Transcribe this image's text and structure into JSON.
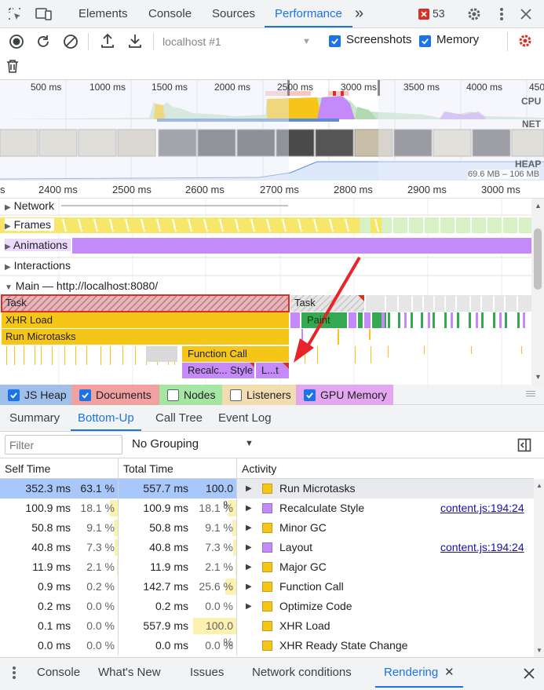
{
  "tabs": {
    "items": [
      {
        "label": "Elements"
      },
      {
        "label": "Console"
      },
      {
        "label": "Sources"
      },
      {
        "label": "Performance"
      }
    ],
    "more_label": "»",
    "error_count": "53"
  },
  "toolbar": {
    "profile_select": "localhost #1",
    "screenshots_label": "Screenshots",
    "screenshots_checked": true,
    "memory_label": "Memory",
    "memory_checked": true
  },
  "overview": {
    "ticks": [
      "500 ms",
      "1000 ms",
      "1500 ms",
      "2000 ms",
      "2500 ms",
      "3000 ms",
      "3500 ms",
      "4000 ms",
      "450"
    ],
    "cpu_label": "CPU",
    "net_label": "NET",
    "heap_label": "HEAP",
    "heap_range": "69.6 MB – 106 MB"
  },
  "ruler": {
    "ticks": [
      "s",
      "2400 ms",
      "2500 ms",
      "2600 ms",
      "2700 ms",
      "2800 ms",
      "2900 ms",
      "3000 ms"
    ]
  },
  "tracks": {
    "network": "Network",
    "frames": "Frames",
    "animations": "Animations",
    "interactions": "Interactions",
    "main": "Main — http://localhost:8080/"
  },
  "flame": {
    "task1": "Task",
    "task2": "Task",
    "xhr_load": "XHR Load",
    "paint": "Paint",
    "run_microtasks": "Run Microtasks",
    "function_call": "Function Call",
    "recalc": "Recalc... Style",
    "layout": "L...t"
  },
  "memory_counters": [
    {
      "label": "JS Heap",
      "checked": true,
      "color": "#a0c0ec"
    },
    {
      "label": "Documents",
      "checked": true,
      "color": "#f2a1a1"
    },
    {
      "label": "Nodes",
      "checked": false,
      "color": "#a5e6a5"
    },
    {
      "label": "Listeners",
      "checked": false,
      "color": "#f2ddb0"
    },
    {
      "label": "GPU Memory",
      "checked": true,
      "color": "#e2a7ee"
    }
  ],
  "subtabs": [
    "Summary",
    "Bottom-Up",
    "Call Tree",
    "Event Log"
  ],
  "filter": {
    "placeholder": "Filter",
    "grouping": "No Grouping"
  },
  "table": {
    "headers": {
      "self_time": "Self Time",
      "total_time": "Total Time",
      "activity": "Activity"
    },
    "rows": [
      {
        "self": "352.3 ms",
        "self_pct": "63.1 %",
        "self_frac": 0.631,
        "total": "557.7 ms",
        "total_pct": "100.0 %",
        "total_frac": 1.0,
        "activity": "Run Microtasks",
        "color": "#f5c518",
        "expandable": true,
        "link": "",
        "selected": true
      },
      {
        "self": "100.9 ms",
        "self_pct": "18.1 %",
        "self_frac": 0.181,
        "total": "100.9 ms",
        "total_pct": "18.1 %",
        "total_frac": 0.181,
        "activity": "Recalculate Style",
        "color": "#c58af9",
        "expandable": true,
        "link": "content.js:194:24",
        "selected": false
      },
      {
        "self": "50.8 ms",
        "self_pct": "9.1 %",
        "self_frac": 0.091,
        "total": "50.8 ms",
        "total_pct": "9.1 %",
        "total_frac": 0.091,
        "activity": "Minor GC",
        "color": "#f5c518",
        "expandable": true,
        "link": "",
        "selected": false
      },
      {
        "self": "40.8 ms",
        "self_pct": "7.3 %",
        "self_frac": 0.073,
        "total": "40.8 ms",
        "total_pct": "7.3 %",
        "total_frac": 0.073,
        "activity": "Layout",
        "color": "#c58af9",
        "expandable": true,
        "link": "content.js:194:24",
        "selected": false
      },
      {
        "self": "11.9 ms",
        "self_pct": "2.1 %",
        "self_frac": 0.021,
        "total": "11.9 ms",
        "total_pct": "2.1 %",
        "total_frac": 0.021,
        "activity": "Major GC",
        "color": "#f5c518",
        "expandable": true,
        "link": "",
        "selected": false
      },
      {
        "self": "0.9 ms",
        "self_pct": "0.2 %",
        "self_frac": 0.002,
        "total": "142.7 ms",
        "total_pct": "25.6 %",
        "total_frac": 0.256,
        "activity": "Function Call",
        "color": "#f5c518",
        "expandable": true,
        "link": "",
        "selected": false
      },
      {
        "self": "0.2 ms",
        "self_pct": "0.0 %",
        "self_frac": 0.0,
        "total": "0.2 ms",
        "total_pct": "0.0 %",
        "total_frac": 0.0,
        "activity": "Optimize Code",
        "color": "#f5c518",
        "expandable": true,
        "link": "",
        "selected": false
      },
      {
        "self": "0.1 ms",
        "self_pct": "0.0 %",
        "self_frac": 0.0,
        "total": "557.9 ms",
        "total_pct": "100.0 %",
        "total_frac": 1.0,
        "activity": "XHR Load",
        "color": "#f5c518",
        "expandable": false,
        "link": "",
        "selected": false
      },
      {
        "self": "0.0 ms",
        "self_pct": "0.0 %",
        "self_frac": 0.0,
        "total": "0.0 ms",
        "total_pct": "0.0 %",
        "total_frac": 0.0,
        "activity": "XHR Ready State Change",
        "color": "#f5c518",
        "expandable": false,
        "link": "",
        "selected": false
      }
    ]
  },
  "drawer": {
    "tabs": [
      "Console",
      "What's New",
      "Issues",
      "Network conditions",
      "Rendering"
    ],
    "active": "Rendering"
  },
  "colors": {
    "accent": "#1a73e8",
    "scripting": "#f5c518",
    "rendering": "#c58af9",
    "painting": "#34a853",
    "selected_row": "#a8c7fa"
  },
  "icons": [
    "inspect-icon",
    "device-toolbar-icon",
    "error-badge-icon",
    "settings-gear-icon",
    "kebab-menu-icon",
    "close-icon",
    "record-icon",
    "reload-icon",
    "clear-icon",
    "upload-icon",
    "download-icon",
    "capture-settings-gear-icon",
    "trash-icon",
    "sidebar-toggle-icon",
    "red-arrow-annotation"
  ]
}
